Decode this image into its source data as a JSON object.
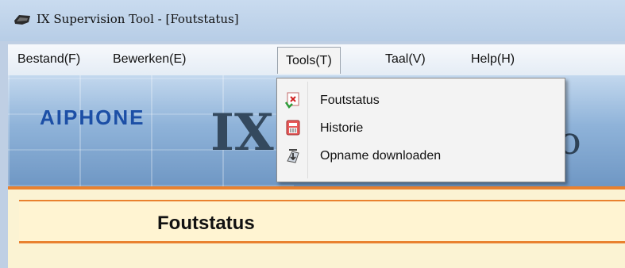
{
  "window": {
    "title": "IX Supervision Tool - [Foutstatus]",
    "icon": "app-icon"
  },
  "menubar": {
    "items": [
      "Bestand(F)",
      "Bewerken(E)",
      "Tools(T)",
      "Taal(V)",
      "Help(H)"
    ],
    "active_index": 2
  },
  "dropdown": {
    "items": [
      {
        "label": "Foutstatus",
        "icon": "error-status-icon"
      },
      {
        "label": "Historie",
        "icon": "history-icon"
      },
      {
        "label": "Opname downloaden",
        "icon": "download-icon"
      }
    ]
  },
  "banner": {
    "logo": "AIPHONE",
    "product_mark": "IX",
    "product_tail": "So",
    "accent_color": "#1c4fa6"
  },
  "page": {
    "header": "Foutstatus",
    "accent_color": "#e9812f"
  }
}
